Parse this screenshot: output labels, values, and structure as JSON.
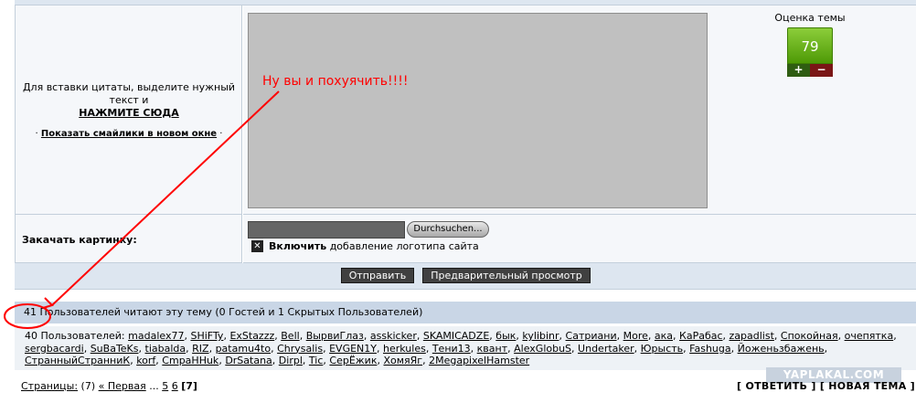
{
  "quote_hint": {
    "text": "Для вставки цитаты, выделите нужный текст и",
    "link": "НАЖМИТЕ СЮДА"
  },
  "smilies": {
    "prefix": "·",
    "link": "Показать смайлики в новом окне",
    "suffix": "·"
  },
  "rating": {
    "title": "Оценка темы",
    "score": "79",
    "plus": "+",
    "minus": "−"
  },
  "annotation": {
    "text": "Ну вы и похуячить!!!!",
    "color": "#ff0000"
  },
  "upload": {
    "label": "Закачать картинку:",
    "file_value": "",
    "browse_label": "Durchsuchen...",
    "checkbox_mark": "✕",
    "checkbox_bold": "Включить",
    "checkbox_rest": "добавление логотипа сайта"
  },
  "buttons": {
    "send": "Отправить",
    "preview": "Предварительный просмотр"
  },
  "readers": {
    "text": "41 Пользователей читают эту тему (0 Гостей и 1 Скрытых Пользователей)"
  },
  "users": {
    "prefix": "40 Пользователей:",
    "names": [
      "madalex77",
      "SHiFTy",
      "ExStazzz",
      "Bell",
      "ВырвиГлаз",
      "asskicker",
      "SKAMICADZE",
      "бык",
      "kylibinr",
      "Сатриани",
      "More",
      "ака",
      "КаРабас",
      "zapadlist",
      "Спокойная",
      "очепятка",
      "sergbacardi",
      "SuBaTeKs",
      "tiabalda",
      "RIZ",
      "patamu4to",
      "Chrysalis",
      "EVGEN1Y",
      "herkules",
      "Тени13",
      "квант",
      "AlexGlobuS",
      "Undertaker",
      "Юрысть",
      "Fashuga",
      "Йоженьзбажень",
      "СтранныйСтранниК",
      "korf",
      "СmpaHHuk",
      "DrSatana",
      "Dirpl",
      "Tic",
      "СерЁжик",
      "ХомяЯг",
      "2MegapixelHamster"
    ]
  },
  "pages": {
    "label": "Страницы:",
    "count": "(7)",
    "first": "« Первая",
    "ellipsis": "...",
    "p5": "5",
    "p6": "6",
    "current": "[7]"
  },
  "reply": {
    "open": "[",
    "reply": "ОТВЕТИТЬ",
    "sep": "] [",
    "new_topic": "НОВАЯ ТЕМА",
    "close": "]"
  },
  "watermark": "YAPLAKAL.COM"
}
